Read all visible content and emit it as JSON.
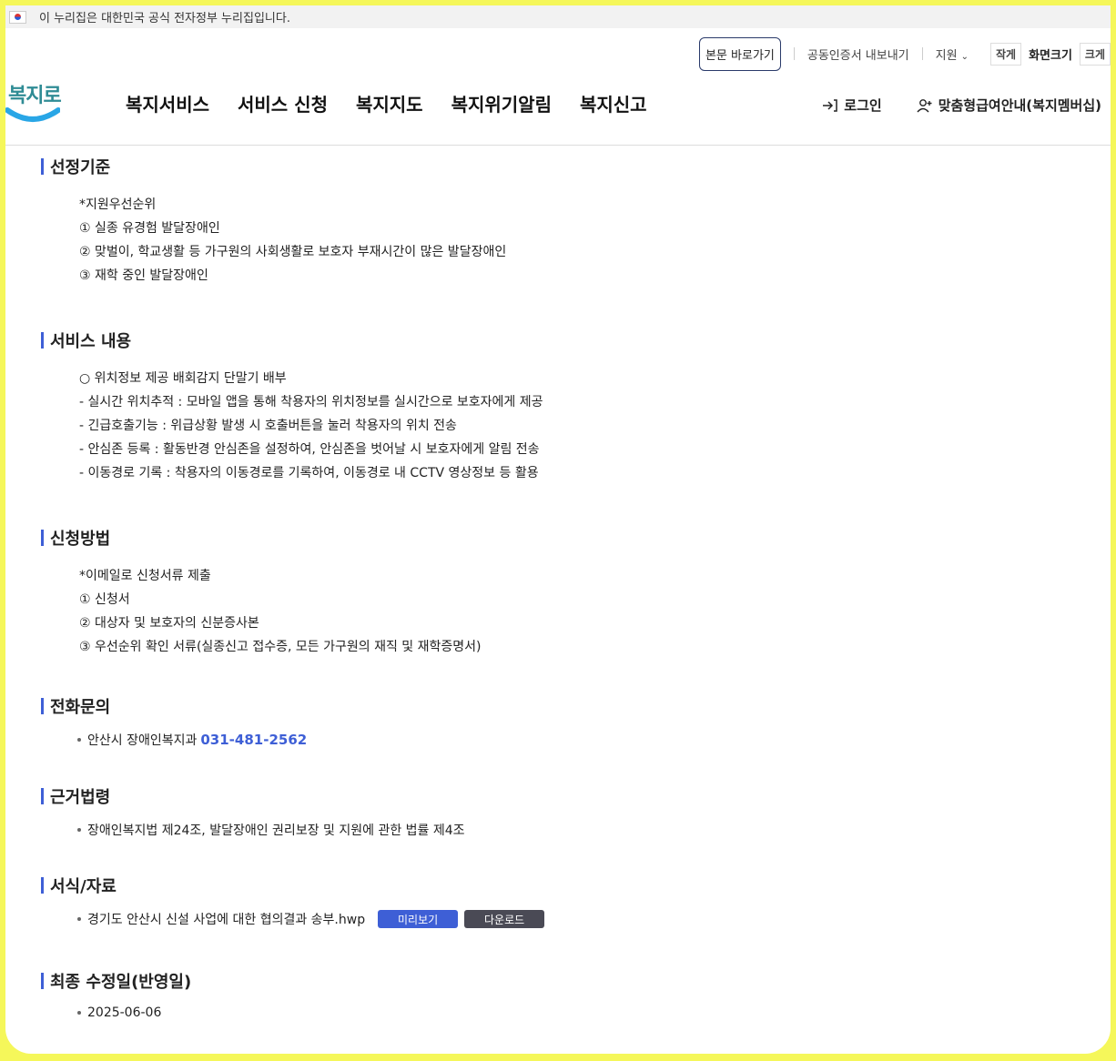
{
  "gov_banner": {
    "text": "이 누리집은 대한민국 공식 전자정부 누리집입니다."
  },
  "util": {
    "skip": "본문 바로가기",
    "cert": "공동인증서 내보내기",
    "support": "지원",
    "small": "작게",
    "screen_size": "화면크기",
    "large": "크게"
  },
  "logo": {
    "text": "복지로"
  },
  "gnb": [
    "복지서비스",
    "서비스 신청",
    "복지지도",
    "복지위기알림",
    "복지신고"
  ],
  "auth": {
    "login": "로그인",
    "membership": "맞춤형급여안내(복지멤버십)"
  },
  "sections": {
    "criteria": {
      "title": "선정기준",
      "lines": [
        "*지원우선순위",
        "① 실종 유경험 발달장애인",
        "② 맞벌이, 학교생활 등 가구원의 사회생활로 보호자 부재시간이 많은 발달장애인",
        "③ 재학 중인 발달장애인"
      ]
    },
    "service": {
      "title": "서비스 내용",
      "lines": [
        "○ 위치정보 제공 배회감지 단말기 배부",
        "- 실시간 위치추적 : 모바일 앱을 통해 착용자의 위치정보를 실시간으로 보호자에게 제공",
        "- 긴급호출기능 : 위급상황 발생 시 호출버튼을 눌러 착용자의 위치 전송",
        "- 안심존 등록 : 활동반경 안심존을 설정하여, 안심존을 벗어날 시 보호자에게 알림 전송",
        "- 이동경로 기록 : 착용자의 이동경로를 기록하여, 이동경로 내 CCTV 영상정보 등 활용"
      ]
    },
    "apply": {
      "title": "신청방법",
      "lines": [
        "*이메일로 신청서류 제출",
        "① 신청서",
        "② 대상자 및 보호자의 신분증사본",
        "③ 우선순위 확인 서류(실종신고 접수증, 모든 가구원의 재직 및 재학증명서)"
      ]
    },
    "phone": {
      "title": "전화문의",
      "org": "안산시 장애인복지과",
      "number": "031-481-2562"
    },
    "law": {
      "title": "근거법령",
      "text": "장애인복지법 제24조, 발달장애인 권리보장 및 지원에 관한 법률 제4조"
    },
    "forms": {
      "title": "서식/자료",
      "file": "경기도 안산시 신설 사업에 대한 협의결과 송부.hwp",
      "preview": "미리보기",
      "download": "다운로드"
    },
    "updated": {
      "title": "최종 수정일(반영일)",
      "date": "2025-06-06"
    }
  }
}
